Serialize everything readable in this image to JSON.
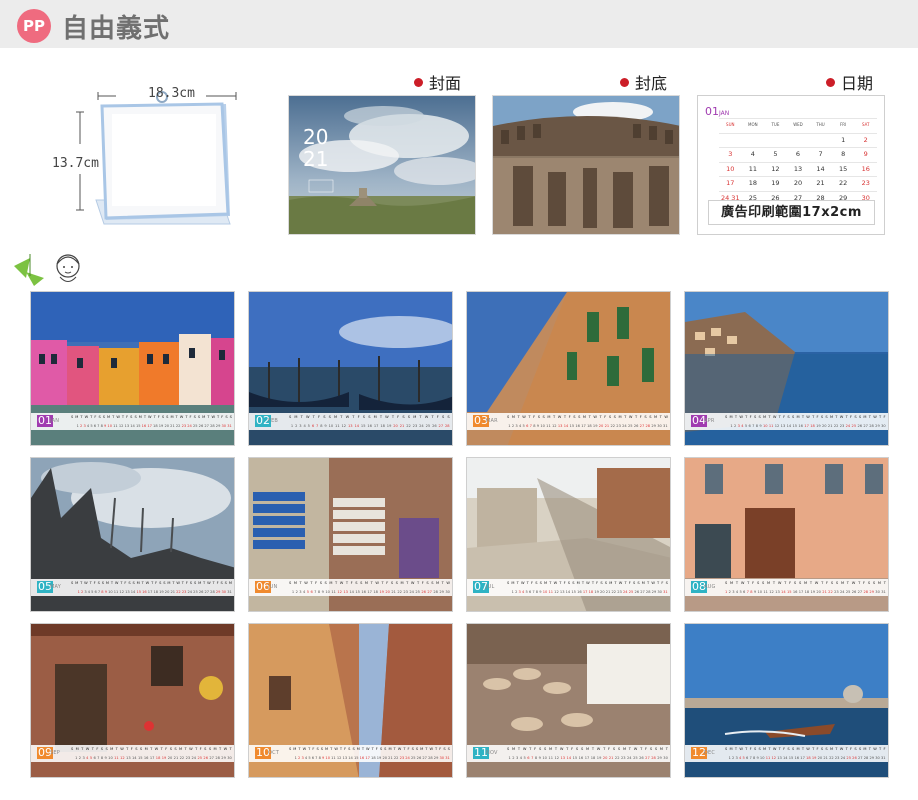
{
  "header": {
    "badge": "PP",
    "title": "自由義式"
  },
  "product": {
    "width_label": "18.3cm",
    "height_label": "13.7cm"
  },
  "labels": {
    "cover": "封面",
    "back": "封底",
    "date": "日期"
  },
  "cover": {
    "year_top": "20",
    "year_bottom": "21"
  },
  "date_page": {
    "month_num": "01",
    "month_name": "JAN",
    "weekdays": [
      "SUN",
      "MON",
      "TUE",
      "WED",
      "THU",
      "FRI",
      "SAT"
    ],
    "weeks": [
      [
        "",
        "",
        "",
        "",
        "",
        "1",
        "2"
      ],
      [
        "3",
        "4",
        "5",
        "6",
        "7",
        "8",
        "9"
      ],
      [
        "10",
        "11",
        "12",
        "13",
        "14",
        "15",
        "16"
      ],
      [
        "17",
        "18",
        "19",
        "20",
        "21",
        "22",
        "23"
      ],
      [
        "24 31",
        "25",
        "26",
        "27",
        "28",
        "29",
        "30"
      ]
    ],
    "ad_text": "廣告印刷範圍17x2cm"
  },
  "colors": {
    "badge": "#ef6b7f",
    "dot": "#cc1e28",
    "frame_blue": "#a9c6e6",
    "purple": "#a03bb0",
    "teal": "#2fb3c4",
    "orange": "#f08a2e"
  },
  "strip_weekdays": [
    "S",
    "M",
    "T",
    "W",
    "T",
    "F",
    "S",
    "S",
    "M",
    "T",
    "W",
    "T",
    "F",
    "S",
    "S",
    "M",
    "T",
    "W",
    "T",
    "F",
    "S",
    "S",
    "M",
    "T",
    "W",
    "T",
    "F",
    "S",
    "S",
    "M",
    "T",
    "W",
    "T",
    "F",
    "S"
  ],
  "months": [
    {
      "num": "01",
      "name": "JAN",
      "color": "#a03bb0",
      "start": 5,
      "days": 31
    },
    {
      "num": "02",
      "name": "FEB",
      "color": "#2fb3c4",
      "start": 1,
      "days": 28
    },
    {
      "num": "03",
      "name": "MAR",
      "color": "#f08a2e",
      "start": 1,
      "days": 31
    },
    {
      "num": "04",
      "name": "APR",
      "color": "#a03bb0",
      "start": 4,
      "days": 30
    },
    {
      "num": "05",
      "name": "MAY",
      "color": "#2fb3c4",
      "start": 6,
      "days": 31
    },
    {
      "num": "06",
      "name": "JUN",
      "color": "#f08a2e",
      "start": 2,
      "days": 30
    },
    {
      "num": "07",
      "name": "JUL",
      "color": "#2fb3c4",
      "start": 4,
      "days": 31
    },
    {
      "num": "08",
      "name": "AUG",
      "color": "#2fb3c4",
      "start": 0,
      "days": 31
    },
    {
      "num": "09",
      "name": "SEP",
      "color": "#f08a2e",
      "start": 3,
      "days": 30
    },
    {
      "num": "10",
      "name": "OCT",
      "color": "#f08a2e",
      "start": 5,
      "days": 31
    },
    {
      "num": "11",
      "name": "NOV",
      "color": "#2fb3c4",
      "start": 1,
      "days": 30
    },
    {
      "num": "12",
      "name": "DEC",
      "color": "#f08a2e",
      "start": 3,
      "days": 31
    }
  ]
}
